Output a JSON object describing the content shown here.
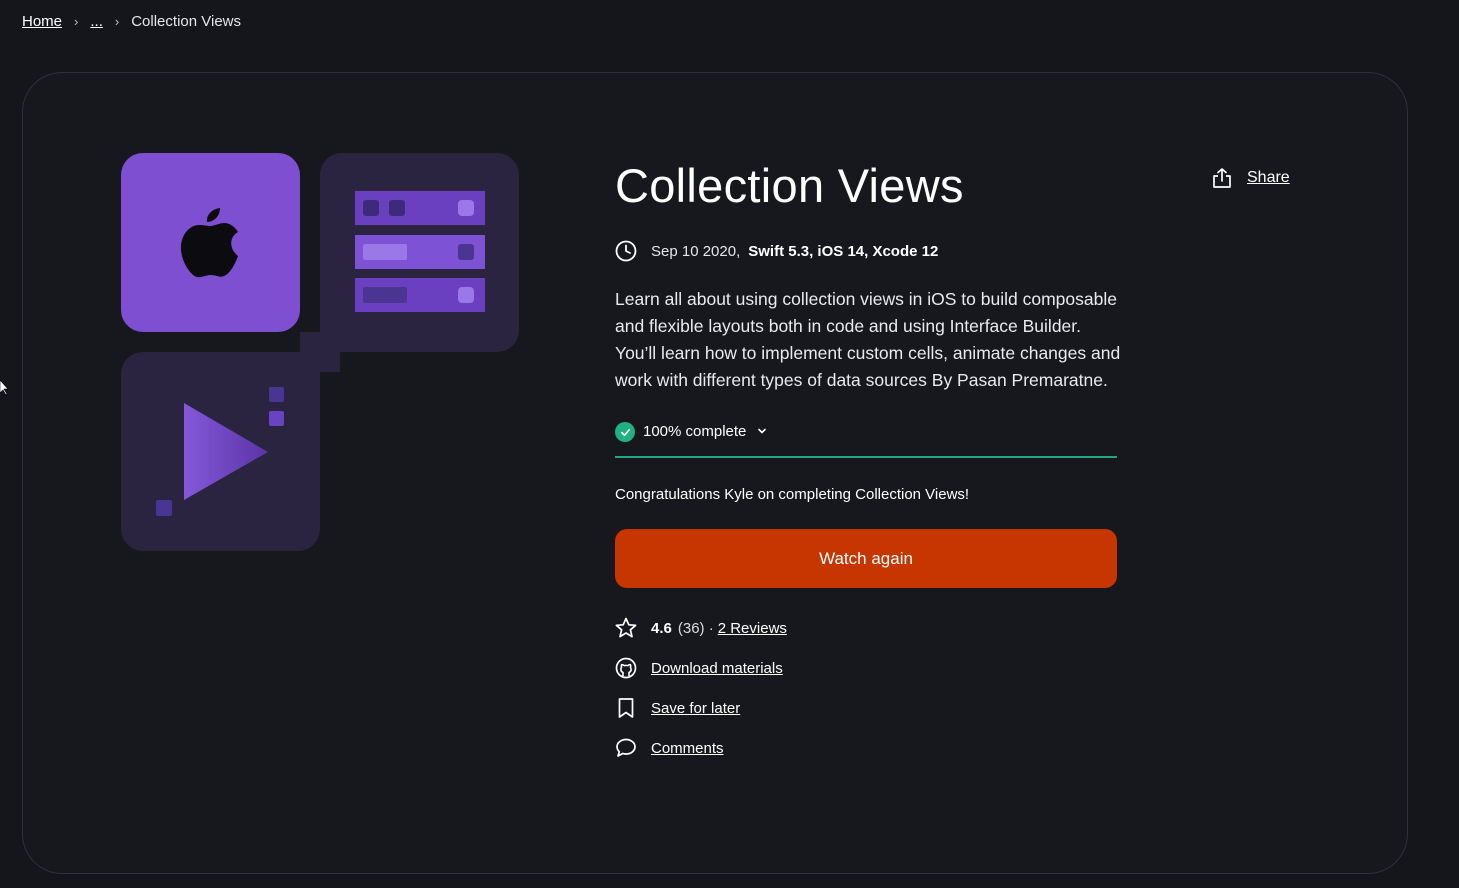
{
  "breadcrumb": {
    "home": "Home",
    "ellipsis": "...",
    "current": "Collection Views"
  },
  "course": {
    "title": "Collection Views",
    "date": "Sep 10 2020,",
    "tech": "Swift 5.3, iOS 14, Xcode 12",
    "description": "Learn all about using collection views in iOS to build composable and flexible layouts both in code and using Interface Builder. You’ll learn how to implement custom cells, animate changes and work with different types of data sources By Pasan Premaratne.",
    "progress_label": "100% complete",
    "congrats": "Congratulations Kyle on completing Collection Views!",
    "watch_label": "Watch again"
  },
  "share_label": "Share",
  "actions": {
    "rating": "4.6",
    "rating_count": "(36) ·",
    "reviews": "2 Reviews",
    "download": "Download materials",
    "save": "Save for later",
    "comments": "Comments"
  },
  "colors": {
    "accent": "#c73500",
    "progress": "#21b07f",
    "art_purple": "#7e4fd0",
    "art_dark": "#2a2440"
  },
  "icons": [
    "clock-icon",
    "check-icon",
    "chevron-down-icon",
    "star-icon",
    "github-icon",
    "bookmark-icon",
    "comment-icon",
    "share-icon",
    "apple-icon",
    "play-icon"
  ]
}
